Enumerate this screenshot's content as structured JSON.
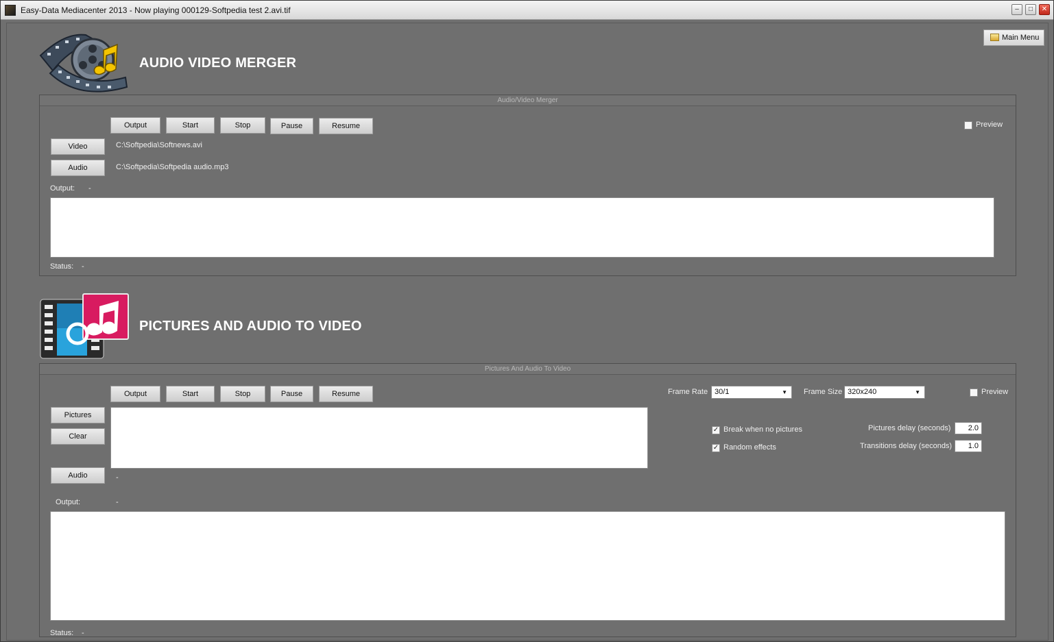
{
  "window": {
    "title": "Easy-Data Mediacenter 2013 - Now playing 000129-Softpedia test 2.avi.tif",
    "minimize": "–",
    "maximize": "□",
    "close": "✕"
  },
  "header": {
    "main_menu_label": "Main Menu"
  },
  "merger": {
    "title": "AUDIO VIDEO MERGER",
    "panel_title": "Audio/Video Merger",
    "buttons": {
      "output": "Output",
      "start": "Start",
      "stop": "Stop",
      "pause": "Pause",
      "resume": "Resume"
    },
    "preview_label": "Preview",
    "video_button": "Video",
    "video_path": "C:\\Softpedia\\Softnews.avi",
    "audio_button": "Audio",
    "audio_path": "C:\\Softpedia\\Softpedia audio.mp3",
    "output_label": "Output:",
    "output_value": "-",
    "status_label": "Status:",
    "status_value": "-"
  },
  "pictures": {
    "title": "PICTURES AND AUDIO TO VIDEO",
    "panel_title": "Pictures And Audio To Video",
    "buttons": {
      "output": "Output",
      "start": "Start",
      "stop": "Stop",
      "pause": "Pause",
      "resume": "Resume"
    },
    "frame_rate_label": "Frame Rate",
    "frame_rate_value": "30/1",
    "frame_size_label": "Frame Size",
    "frame_size_value": "320x240",
    "preview_label": "Preview",
    "pictures_button": "Pictures",
    "clear_button": "Clear",
    "audio_button": "Audio",
    "audio_value": "-",
    "break_label": "Break when no pictures",
    "break_checked": "✓",
    "random_label": "Random effects",
    "random_checked": "✓",
    "pictures_delay_label": "Pictures delay (seconds)",
    "pictures_delay_value": "2.0",
    "transitions_delay_label": "Transitions delay (seconds)",
    "transitions_delay_value": "1.0",
    "output_label": "Output:",
    "output_value": "-",
    "status_label": "Status:",
    "status_value": "-"
  },
  "colors": {
    "background": "#6f6f6f",
    "accent_pink": "#d81b60",
    "accent_blue": "#29a3dc"
  },
  "icons": {
    "app": "app-icon",
    "merger_logo": "film-reel-music-note-icon",
    "pictures_logo": "film-strip-music-note-icon",
    "main_menu": "folder-icon"
  }
}
